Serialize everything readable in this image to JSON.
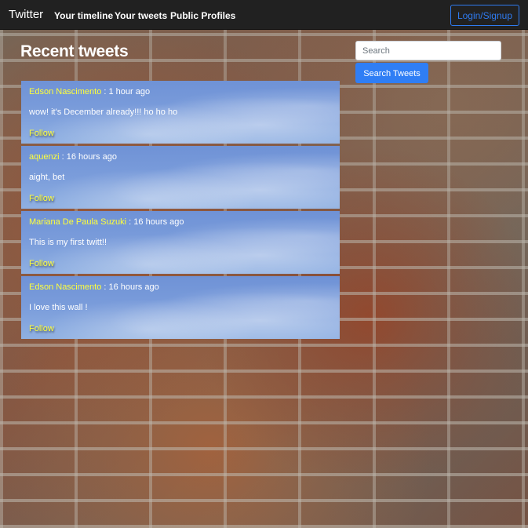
{
  "navbar": {
    "brand": "Twitter",
    "links": [
      "Your timeline",
      "Your tweets",
      "Public Profiles"
    ],
    "login_label": "Login/Signup"
  },
  "page": {
    "title": "Recent tweets"
  },
  "search": {
    "placeholder": "Search",
    "value": "",
    "button_label": "Search Tweets"
  },
  "tweets": [
    {
      "author": "Edson Nascimento",
      "separator": " : ",
      "time": "1 hour ago",
      "text": "wow! it's December already!!! ho ho ho",
      "follow_label": "Follow"
    },
    {
      "author": "aquenzi",
      "separator": " : ",
      "time": "16 hours ago",
      "text": "aight, bet",
      "follow_label": "Follow"
    },
    {
      "author": "Mariana De Paula Suzuki",
      "separator": " : ",
      "time": "16 hours ago",
      "text": "This is my first twitt!!",
      "follow_label": "Follow"
    },
    {
      "author": "Edson Nascimento",
      "separator": " : ",
      "time": "16 hours ago",
      "text": "I love this wall !",
      "follow_label": "Follow"
    }
  ],
  "colors": {
    "navbar_bg": "#212121",
    "accent_blue": "#2f7ef5",
    "author_yellow": "#ffff3a",
    "tweet_card": "#7b9ddb"
  }
}
